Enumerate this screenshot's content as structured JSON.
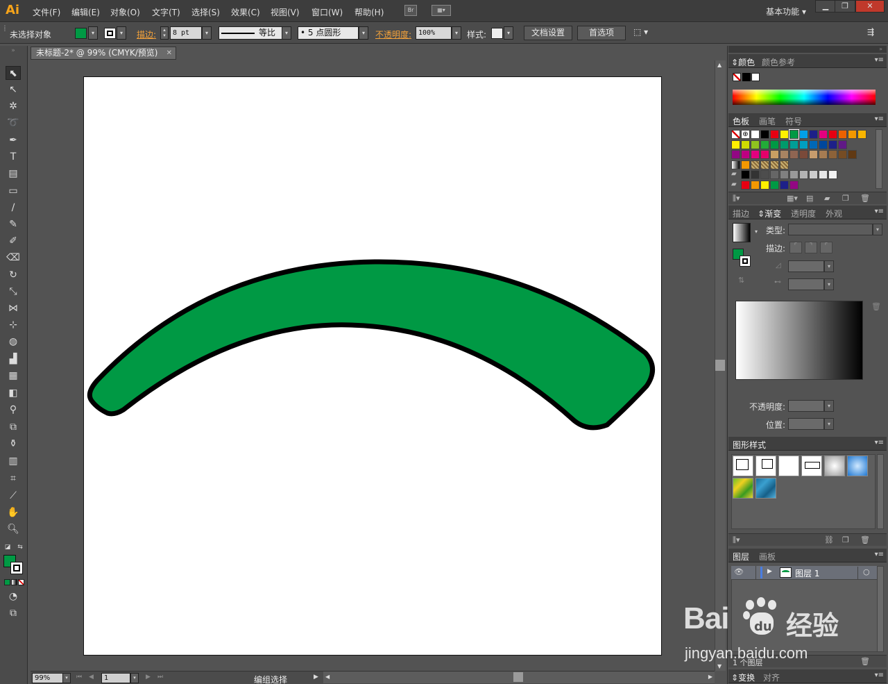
{
  "app": {
    "logo": "Ai"
  },
  "menu": {
    "items": [
      "文件(F)",
      "编辑(E)",
      "对象(O)",
      "文字(T)",
      "选择(S)",
      "效果(C)",
      "视图(V)",
      "窗口(W)",
      "帮助(H)"
    ],
    "bridge_icon": "Br",
    "workspace": "基本功能"
  },
  "control": {
    "selection_status": "未选择对象",
    "stroke_label": "描边:",
    "stroke_weight": "8 pt",
    "profile_label": "等比",
    "brush_size": "5",
    "brush_label": "点圆形",
    "opacity_label": "不透明度:",
    "opacity_value": "100%",
    "style_label": "样式:",
    "doc_setup": "文档设置",
    "preferences": "首选项"
  },
  "document": {
    "tab_title": "未标题-2* @ 99% (CMYK/预览)",
    "fill_color": "#009944",
    "stroke_color": "#000000"
  },
  "status": {
    "zoom": "99%",
    "artboard_num": "1",
    "text": "编组选择"
  },
  "panels": {
    "color": {
      "tabs": [
        "颜色",
        "颜色参考"
      ]
    },
    "swatches": {
      "tabs": [
        "色板",
        "画笔",
        "符号"
      ]
    },
    "gradient": {
      "tabs": [
        "描边",
        "渐变",
        "透明度",
        "外观"
      ],
      "type_label": "类型:",
      "stroke_label": "描边:",
      "opacity_label": "不透明度:",
      "position_label": "位置:"
    },
    "graphic_styles": {
      "tabs": [
        "图形样式"
      ]
    },
    "layers": {
      "tabs": [
        "图层",
        "画板"
      ],
      "layer_name": "图层 1",
      "footer": "1 个图层"
    },
    "transform": {
      "tabs": [
        "变换",
        "对齐"
      ]
    }
  },
  "watermark": {
    "brand": "Bai",
    "brand2": "经验",
    "url": "jingyan.baidu.com"
  }
}
